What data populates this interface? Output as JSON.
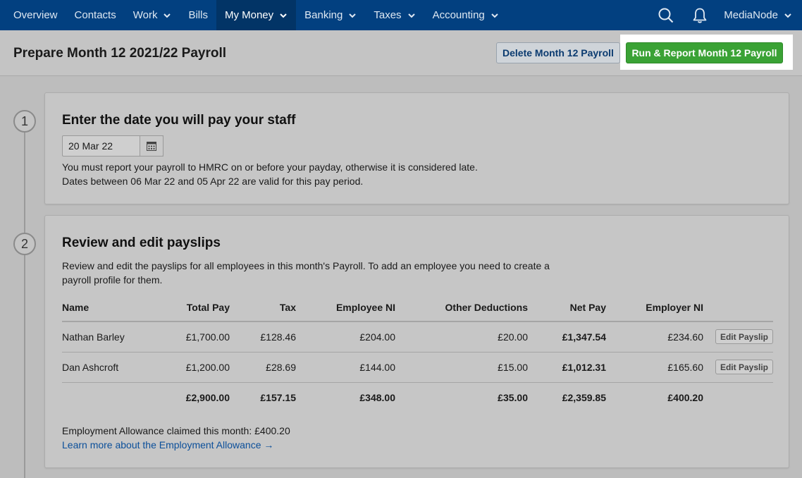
{
  "nav": {
    "items": [
      {
        "label": "Overview",
        "dropdown": false
      },
      {
        "label": "Contacts",
        "dropdown": false
      },
      {
        "label": "Work",
        "dropdown": true
      },
      {
        "label": "Bills",
        "dropdown": false
      },
      {
        "label": "My Money",
        "dropdown": true,
        "active": true
      },
      {
        "label": "Banking",
        "dropdown": true
      },
      {
        "label": "Taxes",
        "dropdown": true
      },
      {
        "label": "Accounting",
        "dropdown": true
      }
    ],
    "user": "MediaNode",
    "icons": [
      "search-icon",
      "bell-icon",
      "chevron-down-icon"
    ]
  },
  "header": {
    "title": "Prepare Month 12 2021/22 Payroll",
    "delete_label": "Delete Month 12 Payroll",
    "run_label": "Run & Report Month 12 Payroll"
  },
  "step1": {
    "number": "1",
    "title": "Enter the date you will pay your staff",
    "date_value": "20 Mar 22",
    "note_line1": "You must report your payroll to HMRC on or before your payday, otherwise it is considered late.",
    "note_line2": "Dates between 06 Mar 22 and 05 Apr 22 are valid for this pay period."
  },
  "step2": {
    "number": "2",
    "title": "Review and edit payslips",
    "desc_line1": "Review and edit the payslips for all employees in this month's Payroll. To add an employee you need to create a",
    "desc_line2": "payroll profile for them.",
    "columns": [
      "Name",
      "Total Pay",
      "Tax",
      "Employee NI",
      "Other Deductions",
      "Net Pay",
      "Employer NI"
    ],
    "rows": [
      {
        "name": "Nathan Barley",
        "total_pay": "£1,700.00",
        "tax": "£128.46",
        "employee_ni": "£204.00",
        "other_deductions": "£20.00",
        "net_pay": "£1,347.54",
        "employer_ni": "£234.60",
        "action": "Edit Payslip"
      },
      {
        "name": "Dan Ashcroft",
        "total_pay": "£1,200.00",
        "tax": "£28.69",
        "employee_ni": "£144.00",
        "other_deductions": "£15.00",
        "net_pay": "£1,012.31",
        "employer_ni": "£165.60",
        "action": "Edit Payslip"
      }
    ],
    "totals": {
      "total_pay": "£2,900.00",
      "tax": "£157.15",
      "employee_ni": "£348.00",
      "other_deductions": "£35.00",
      "net_pay": "£2,359.85",
      "employer_ni": "£400.20"
    },
    "allowance_text": "Employment Allowance claimed this month: £400.20",
    "learn_more": "Learn more about the Employment Allowance →"
  },
  "colors": {
    "nav_bg": "#024080",
    "run_button": "#3aa235",
    "link": "#0b4f9a"
  }
}
